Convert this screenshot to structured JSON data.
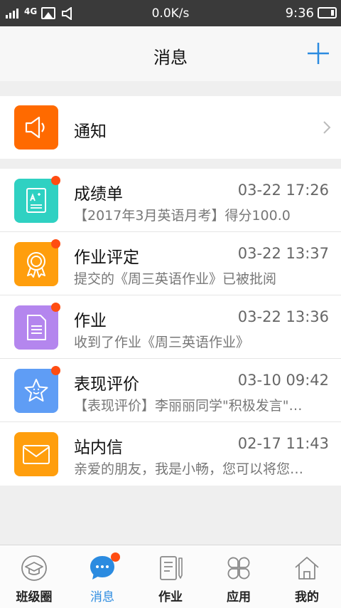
{
  "status_bar": {
    "network": "4G",
    "speed": "0.0K/s",
    "time": "9:36"
  },
  "header": {
    "title": "消息",
    "add_icon": "plus-icon"
  },
  "notice": {
    "label": "通知",
    "icon": "speaker-icon",
    "icon_color": "#ff6a00"
  },
  "messages": [
    {
      "title": "成绩单",
      "time": "03-22 17:26",
      "subtitle": "【2017年3月英语月考】得分100.0",
      "icon": "report-card-icon",
      "icon_color": "#2fd1c2",
      "unread": true
    },
    {
      "title": "作业评定",
      "time": "03-22 13:37",
      "subtitle": "提交的《周三英语作业》已被批阅",
      "icon": "award-icon",
      "icon_color": "#ff9e0d",
      "unread": true
    },
    {
      "title": "作业",
      "time": "03-22 13:36",
      "subtitle": "收到了作业《周三英语作业》",
      "icon": "document-icon",
      "icon_color": "#b486ee",
      "unread": true
    },
    {
      "title": "表现评价",
      "time": "03-10 09:42",
      "subtitle": "【表现评价】李丽丽同学\"积极发言\"…",
      "icon": "star-icon",
      "icon_color": "#5f9df5",
      "unread": true
    },
    {
      "title": "站内信",
      "time": "02-17 11:43",
      "subtitle": "亲爱的朋友，我是小畅，您可以将您…",
      "icon": "mail-icon",
      "icon_color": "#ff9e0d",
      "unread": false
    }
  ],
  "tabs": [
    {
      "label": "班级圈",
      "icon": "graduation-cap-icon",
      "active": false
    },
    {
      "label": "消息",
      "icon": "chat-bubble-icon",
      "active": true,
      "badge": true
    },
    {
      "label": "作业",
      "icon": "notebook-pen-icon",
      "active": false
    },
    {
      "label": "应用",
      "icon": "apps-grid-icon",
      "active": false
    },
    {
      "label": "我的",
      "icon": "home-icon",
      "active": false
    }
  ],
  "colors": {
    "accent": "#2b8be0",
    "badge": "#ff4d12"
  }
}
